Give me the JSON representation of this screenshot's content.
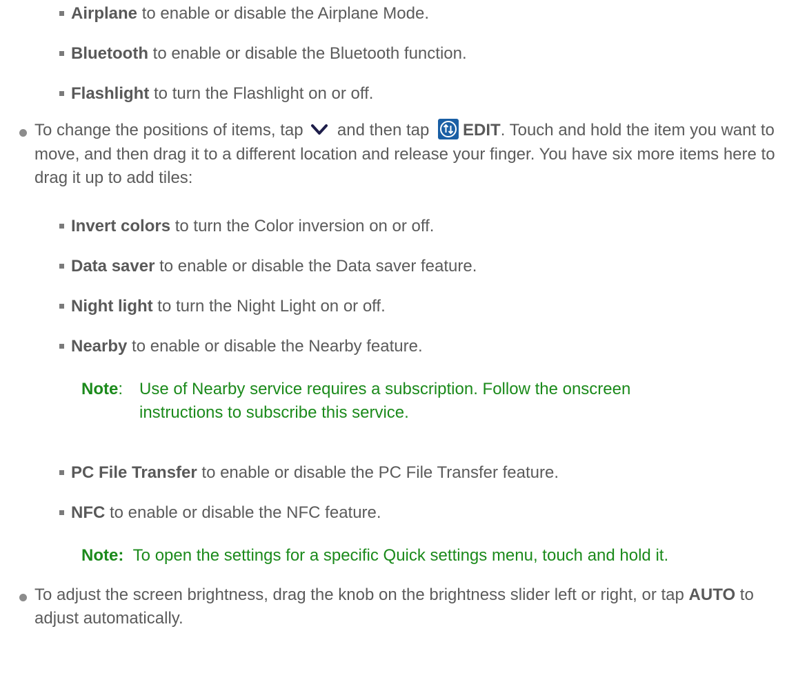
{
  "items_top": [
    {
      "bold": "Airplane",
      "text": " to enable or disable the Airplane Mode."
    },
    {
      "bold": "Bluetooth",
      "text": " to enable or disable the Bluetooth function."
    },
    {
      "bold": "Flashlight",
      "text": " to turn the Flashlight on or off."
    }
  ],
  "edit_para": {
    "t1": "To change the positions of items, tap ",
    "t2": " and then tap ",
    "edit": "EDIT",
    "t3": ". Touch and hold the item you want to move, and then drag it to a different location and release your finger. You have six more items here to drag it up to add tiles:"
  },
  "items_mid": [
    {
      "bold": "Invert colors",
      "text": " to turn the Color inversion on or off."
    },
    {
      "bold": "Data saver",
      "text": " to enable or disable the Data saver feature."
    },
    {
      "bold": "Night light",
      "text": " to turn the Night Light on or off."
    },
    {
      "bold": "Nearby",
      "text": " to enable or disable the Nearby feature."
    }
  ],
  "note1": {
    "label": "Note",
    "colon": ":",
    "line1": "Use of Nearby service requires a subscription. Follow the onscreen",
    "line2": "instructions to subscribe this service."
  },
  "items_bottom": [
    {
      "bold": "PC File Transfer",
      "text": " to enable or disable the PC File Transfer feature."
    },
    {
      "bold": "NFC",
      "text": " to enable or disable the NFC feature."
    }
  ],
  "note2": {
    "label": "Note:",
    "text": "To open the settings for a specific Quick settings menu, touch and hold it."
  },
  "brightness_para": {
    "t1": "To adjust the screen brightness, drag the knob on the brightness slider left or right, or tap ",
    "auto": "AUTO",
    "t2": " to adjust automatically."
  },
  "colors": {
    "note_green": "#1b8a1b",
    "icon_blue": "#1a5fa5"
  },
  "icons": [
    "chevron-down-icon",
    "edit-swap-icon"
  ]
}
